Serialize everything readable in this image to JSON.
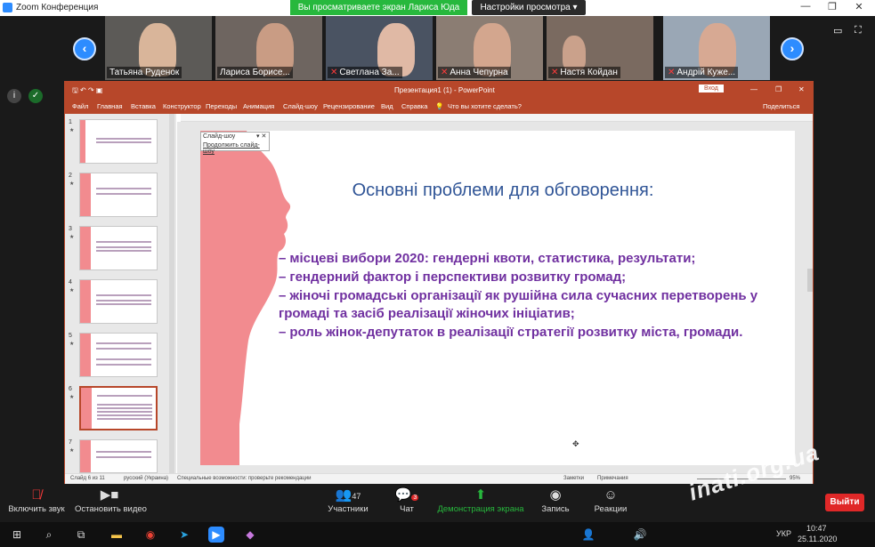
{
  "window": {
    "title": "Zoom Конференция"
  },
  "share_banner": "Вы просматриваете экран Лариса Юда",
  "view_options": "Настройки просмотра",
  "participants": [
    {
      "name": "Татьяна Руденок",
      "muted": false
    },
    {
      "name": "Лариса Борисе...",
      "muted": false
    },
    {
      "name": "Светлана За...",
      "muted": true
    },
    {
      "name": "Анна Чепурна",
      "muted": true
    },
    {
      "name": "Настя Койдан",
      "muted": true
    },
    {
      "name": "Андрій Куже...",
      "muted": true
    }
  ],
  "ppt": {
    "login": "Вход",
    "title": "Презентация1 (1) - PowerPoint",
    "ribbon_tabs": [
      "Файл",
      "Главная",
      "Вставка",
      "Конструктор",
      "Переходы",
      "Анимация",
      "Слайд-шоу",
      "Рецензирование",
      "Вид",
      "Справка"
    ],
    "tell_me": "Что вы хотите сделать?",
    "share": "Поделиться",
    "popup": {
      "title": "Слайд-шоу",
      "action": "Продолжить слайд-шоу"
    },
    "slide_numbers": [
      "1",
      "2",
      "3",
      "4",
      "5",
      "6",
      "7"
    ],
    "status": {
      "slide": "Слайд 6 из 11",
      "language": "русский (Украина)",
      "accessibility": "Специальные возможности: проверьте рекомендации",
      "notes": "Заметки",
      "comments": "Примечания",
      "zoom": "95%"
    }
  },
  "slide": {
    "title": "Основні проблеми для обговорення:",
    "items": [
      "місцеві вибори 2020: гендерні квоти, статистика, результати;",
      "гендерний фактор і перспективи розвитку громад;",
      "жіночі громадські організації як рушійна сила сучасних перетворень у громаді та засіб реалізації жіночих ініціатив;",
      "роль жінок-депутаток в реалізації стратегії розвитку міста, громади."
    ]
  },
  "controls": {
    "audio": "Включить звук",
    "video": "Остановить видео",
    "participants": "Участники",
    "participants_count": "47",
    "chat": "Чат",
    "chat_badge": "3",
    "share": "Демонстрация экрана",
    "record": "Запись",
    "reactions": "Реакции",
    "leave": "Выйти"
  },
  "taskbar": {
    "lang": "УКР",
    "time": "10:47",
    "date": "25.11.2020"
  },
  "watermark": "inati.org.ua",
  "colors": {
    "ppt_accent": "#b7472a",
    "zoom_blue": "#2d8cff",
    "share_green": "#27b83d",
    "slide_pink": "#f28b8f",
    "slide_purple": "#7030a0",
    "slide_title": "#2f5496"
  }
}
